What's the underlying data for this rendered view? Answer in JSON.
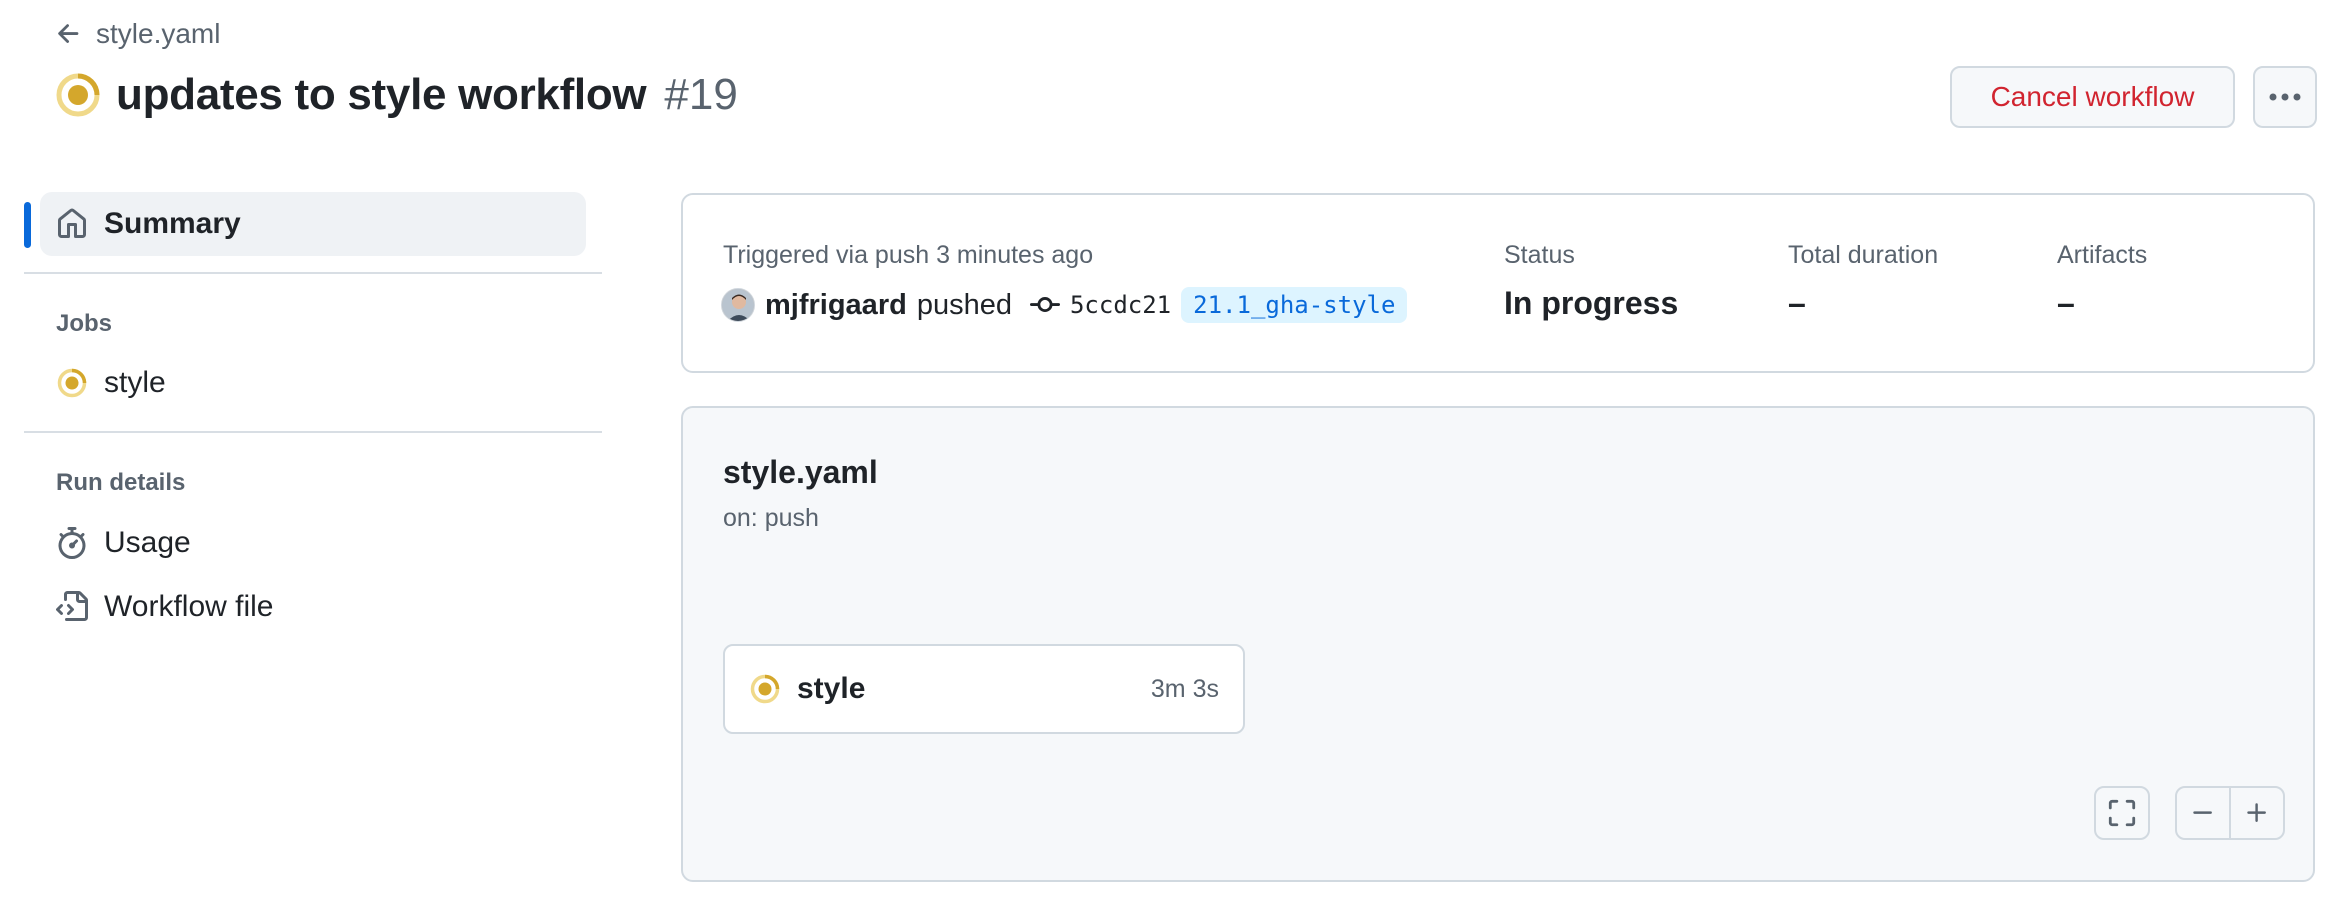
{
  "header": {
    "back_label": "style.yaml",
    "run_title": "updates to style workflow",
    "run_number": "#19",
    "cancel_label": "Cancel workflow"
  },
  "sidebar": {
    "summary_label": "Summary",
    "jobs_heading": "Jobs",
    "jobs": [
      {
        "label": "style",
        "status": "in-progress"
      }
    ],
    "run_details_heading": "Run details",
    "run_details": [
      {
        "label": "Usage",
        "icon": "stopwatch-icon"
      },
      {
        "label": "Workflow file",
        "icon": "file-code-icon"
      }
    ]
  },
  "summary": {
    "trigger_text": "Triggered via push 3 minutes ago",
    "actor": "mjfrigaard",
    "action": "pushed",
    "commit_sha": "5ccdc21",
    "branch": "21.1_gha-style",
    "status_label": "Status",
    "status_value": "In progress",
    "duration_label": "Total duration",
    "duration_value": "–",
    "artifacts_label": "Artifacts",
    "artifacts_value": "–"
  },
  "graph": {
    "workflow_name": "style.yaml",
    "trigger": "on: push",
    "job_name": "style",
    "job_duration": "3m 3s"
  },
  "colors": {
    "in_progress": "#bf8700",
    "accent": "#0969da",
    "danger": "#d1242f"
  }
}
